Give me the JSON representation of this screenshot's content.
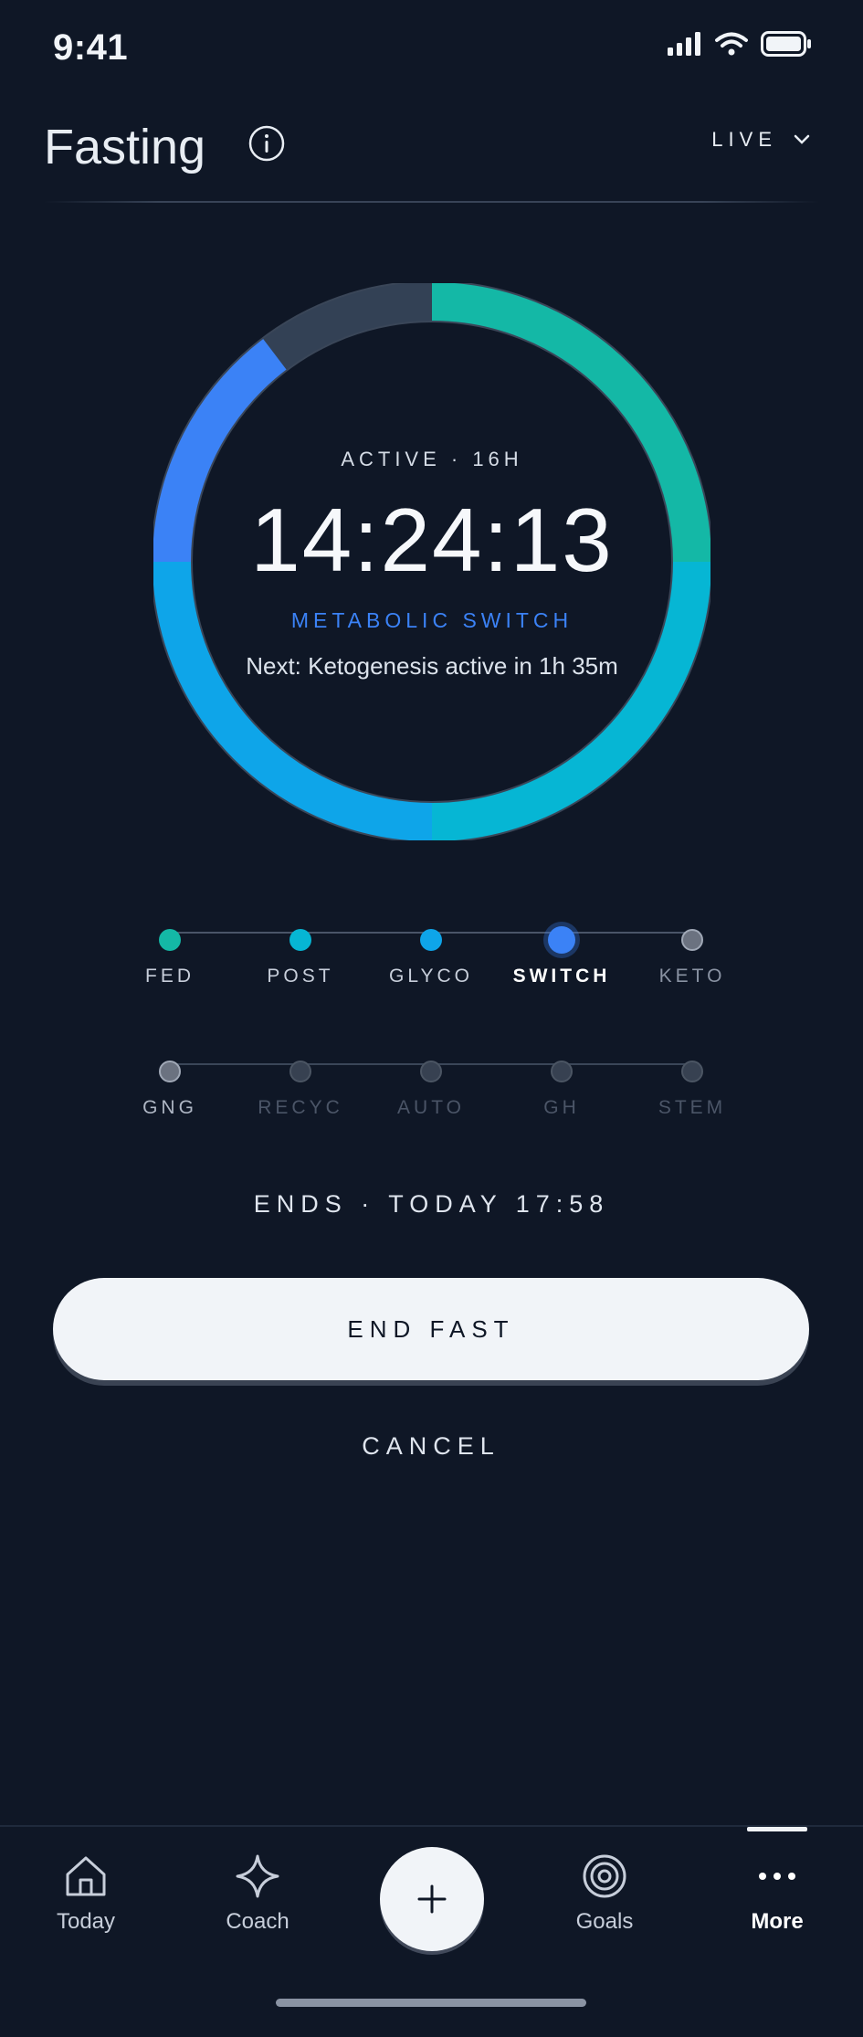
{
  "status_bar": {
    "time": "9:41"
  },
  "header": {
    "title": "Fasting",
    "mode_label": "LIVE"
  },
  "timer": {
    "status": "ACTIVE · 16H",
    "elapsed": "14:24:13",
    "phase": "METABOLIC SWITCH",
    "next": "Next: Ketogenesis active in 1h 35m",
    "progress_fraction": 0.9
  },
  "stages_row1": [
    {
      "label": "FED",
      "color": "#14b8a6",
      "state": "done"
    },
    {
      "label": "POST",
      "color": "#06b6d4",
      "state": "done"
    },
    {
      "label": "GLYCO",
      "color": "#0ea5e9",
      "state": "done"
    },
    {
      "label": "SWITCH",
      "color": "#3b82f6",
      "state": "current"
    },
    {
      "label": "KETO",
      "color": "#6b7280",
      "state": "upcoming"
    }
  ],
  "stages_row2": [
    {
      "label": "GNG",
      "state": "upcoming"
    },
    {
      "label": "RECYC",
      "state": "locked"
    },
    {
      "label": "AUTO",
      "state": "locked"
    },
    {
      "label": "GH",
      "state": "locked"
    },
    {
      "label": "STEM",
      "state": "locked"
    }
  ],
  "ends_text": "ENDS · TODAY 17:58",
  "actions": {
    "end_label": "END FAST",
    "cancel_label": "CANCEL"
  },
  "tabs": [
    {
      "label": "Today",
      "icon": "home-icon"
    },
    {
      "label": "Coach",
      "icon": "sparkle-icon"
    },
    {
      "label": "",
      "icon": "plus-icon"
    },
    {
      "label": "Goals",
      "icon": "target-icon"
    },
    {
      "label": "More",
      "icon": "more-dots-icon",
      "active": true
    }
  ],
  "colors": {
    "background": "#0f1726",
    "accent_blue": "#3b82f6",
    "teal": "#14b8a6",
    "cyan": "#06b6d4",
    "sky": "#0ea5e9"
  }
}
